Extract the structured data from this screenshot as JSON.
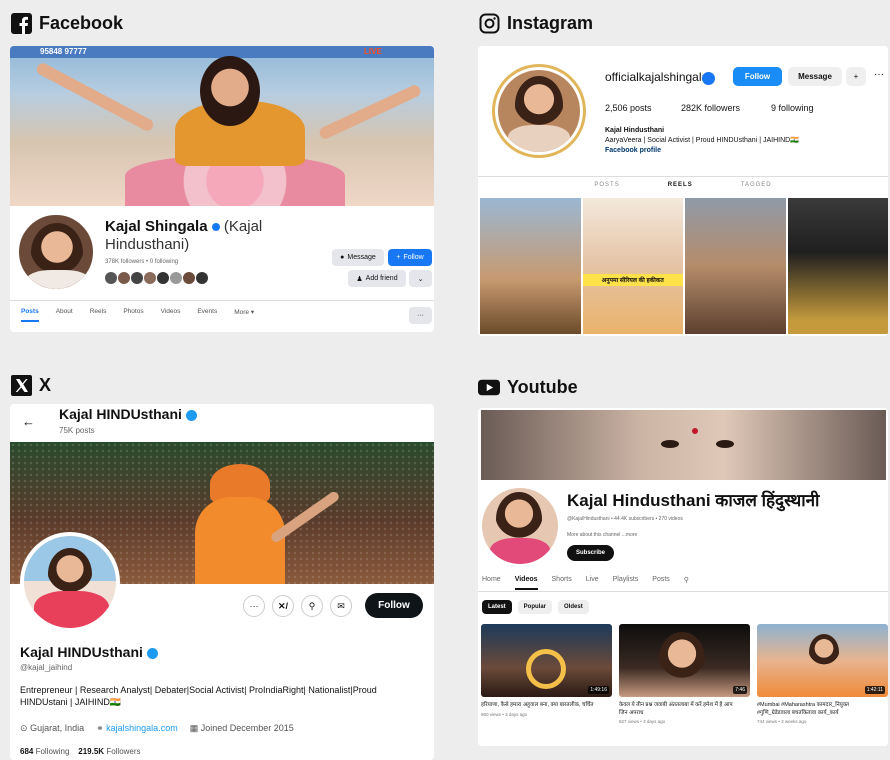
{
  "facebook": {
    "heading": "Facebook",
    "name": "Kajal Shingala",
    "alt_name": "(Kajal Hindusthani)",
    "stats": "378K followers • 0 following",
    "message_btn": "Message",
    "follow_btn": "Follow",
    "add_friend_btn": "Add friend",
    "tabs": [
      "Posts",
      "About",
      "Reels",
      "Photos",
      "Videos",
      "Events",
      "More ▾"
    ],
    "cover_text_left": "95848 97777",
    "cover_text_right": "LIVE",
    "colors": {
      "brand": "#1877f2"
    }
  },
  "instagram": {
    "heading": "Instagram",
    "username": "officialkajalshingala",
    "follow_btn": "Follow",
    "message_btn": "Message",
    "posts": "2,506 posts",
    "followers": "282K followers",
    "following": "9 following",
    "bio_name": "Kajal Hindusthani",
    "bio_line": "AaryaVeera | Social Activist | Proud HINDUsthani | JAIHIND🇮🇳",
    "bio_link": "Facebook profile",
    "tabs": [
      "POSTS",
      "REELS",
      "TAGGED"
    ],
    "grid_caption": "अनुपमा सीरियल की हकीकत"
  },
  "x": {
    "heading": "X",
    "header_name": "Kajal HINDUsthani",
    "posts_count": "75K posts",
    "profile_name": "Kajal HINDUsthani",
    "handle": "@kajal_jaihind",
    "bio": "Entrepreneur | Research Analyst| Debater|Social Activist| ProIndiaRight| Nationalist|Proud HINDUstani | JAIHIND🇮🇳",
    "location": "Gujarat, India",
    "website": "kajalshingala.com",
    "joined": "Joined December 2015",
    "following_count": "684",
    "following_label": "Following",
    "followers_count": "219.5K",
    "followers_label": "Followers",
    "follow_btn": "Follow"
  },
  "youtube": {
    "heading": "Youtube",
    "channel_name": "Kajal Hindusthani काजल हिंदुस्थानी",
    "channel_sub": "@KajalHindusthani • 44.4K subscribers • 270 videos",
    "more_about": "More about this channel ...more",
    "subscribe_btn": "Subscribe",
    "tabs": [
      "Home",
      "Videos",
      "Shorts",
      "Live",
      "Playlists",
      "Posts"
    ],
    "chips": [
      "Latest",
      "Popular",
      "Oldest"
    ],
    "videos": [
      {
        "title": "हरियाणा, कैसे हमारा अहुवाल बना, क्या बारतलीक, चर्चित",
        "meta": "960 views • 3 days ago",
        "duration": "1:49:16"
      },
      {
        "title": "केवल ये तीन प्रश्न जवाबी अंततलाबा में करें हमेश में है आप जिन अपराध",
        "meta": "827 views • 3 days ago",
        "duration": "7:46"
      },
      {
        "title": "#Mumbai #Maharashtra कामदार_नियुक्त #गुणि_ग्रेडेडवाला बचतकितावा कार्य_कार्य",
        "meta": "744 views • 3 weeks ago",
        "duration": "1:42:11"
      }
    ]
  }
}
